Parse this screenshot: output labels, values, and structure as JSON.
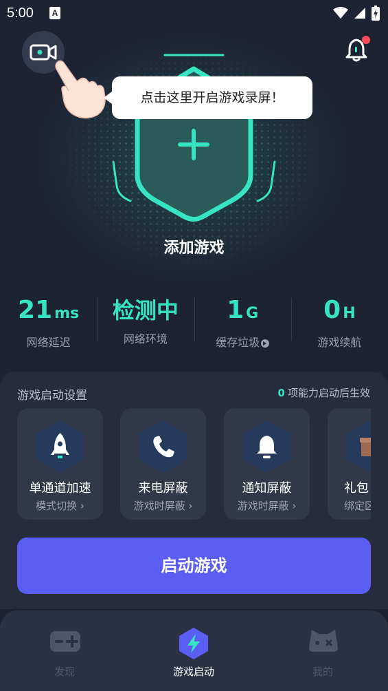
{
  "status_bar": {
    "time": "5:00",
    "notification_glyph": "A"
  },
  "header": {
    "record_icon": "video-camera-icon",
    "tooltip": "点击这里开启游戏录屏！",
    "bell_icon": "bell-icon",
    "bell_badge_color": "#ff4d5a"
  },
  "hero": {
    "add_label": "添加游戏",
    "accent": "#37e3c2"
  },
  "stats": [
    {
      "value": "21",
      "unit": "ms",
      "label": "网络延迟"
    },
    {
      "value": "检测中",
      "unit": "",
      "label": "网络环境"
    },
    {
      "value": "1",
      "unit": "G",
      "label": "缓存垃圾"
    },
    {
      "value": "0",
      "unit": "H",
      "label": "游戏续航"
    }
  ],
  "settings": {
    "title": "游戏启动设置",
    "note_count": "0",
    "note_text": "项能力启动后生效",
    "features": [
      {
        "title": "单通道加速",
        "sub": "模式切换 ›",
        "icon": "rocket-icon"
      },
      {
        "title": "来电屏蔽",
        "sub": "游戏时屏蔽 ›",
        "icon": "phone-icon"
      },
      {
        "title": "通知屏蔽",
        "sub": "游戏时屏蔽 ›",
        "icon": "bell-icon"
      },
      {
        "title": "礼包",
        "sub": "绑定区",
        "icon": "gift-icon"
      }
    ],
    "start_button": "启动游戏"
  },
  "bottom_nav": {
    "items": [
      {
        "label": "发现",
        "icon": "gamepad-icon",
        "active": false
      },
      {
        "label": "游戏启动",
        "icon": "lightning-icon",
        "active": true
      },
      {
        "label": "我的",
        "icon": "profile-icon",
        "active": false
      }
    ]
  },
  "colors": {
    "background": "#1e2333",
    "primary_button": "#5b5ef2",
    "accent": "#37e3c2"
  }
}
